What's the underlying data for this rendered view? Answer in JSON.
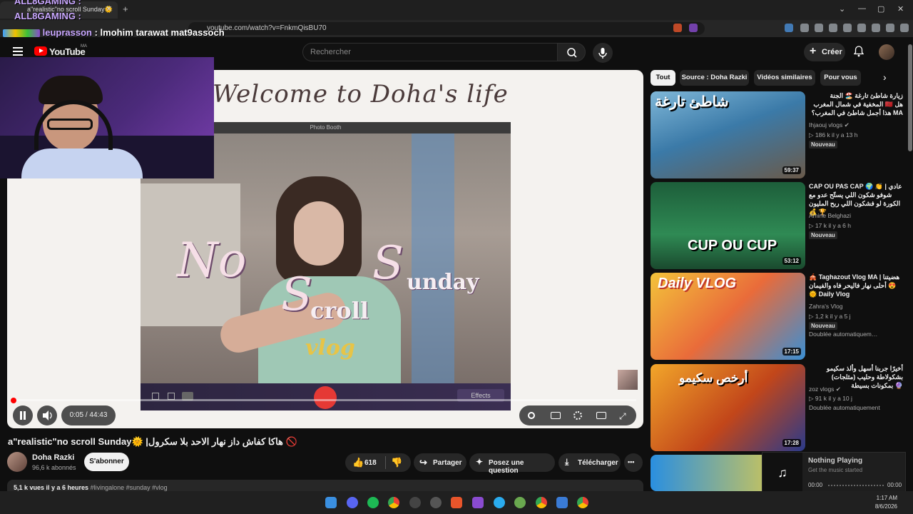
{
  "browser": {
    "tab_title": "a\"realistic\"no scroll Sunday🌞",
    "tab_close": "✕",
    "new_tab": "+",
    "url": "youtube.com/watch?v=FnkmQisBU70"
  },
  "overlay": {
    "name_1": "ALL8GAMING :",
    "name_2": "ALL8GAMING :",
    "chat_user": "leuprasson",
    "chat_message": " : lmohim tarawat mat9assoch"
  },
  "header": {
    "logo": "YouTube",
    "country": "MA",
    "search_placeholder": "Rechercher",
    "create_label": "Créer",
    "create_plus": "+"
  },
  "player": {
    "welcome_text": "Welcome to Doha's life",
    "booth_title": "Photo Booth",
    "effects_label": "Effects",
    "overlay_no": "No",
    "overlay_scroll_s": "S",
    "overlay_scroll": "croll",
    "overlay_sunday_s": "S",
    "overlay_sunday": "unday",
    "overlay_vlog": "vlog",
    "time_display": "0:05 / 44:43",
    "progress": 0.0019
  },
  "video": {
    "title": "a\"realistic\"no scroll Sunday🌞 |هاكا كفاش داز نهار الاحد بلا سكرول 🚫",
    "channel": "Doha Razki",
    "subscribers": "96,6 k abonnés",
    "subscribe_label": "S'abonner",
    "likes": "618",
    "share_label": "Partager",
    "ask_label": "Posez une question",
    "download_label": "Télécharger",
    "more": "•••",
    "views": "5,1 k vues  il y a 6 heures ",
    "tags": "#livingalone #sunday #vlog"
  },
  "chips": [
    "Tout",
    "Source : Doha Razki",
    "Vidéos similaires",
    "Pour vous"
  ],
  "recommendations": [
    {
      "title": "زيارة شاطئ تارغة 🏖️ الجنة المخفية في شمال المغرب 🇲🇦 هل هذا أجمل شاطئ في المغرب؟ MA",
      "channel": "Ihjaouj vlogs ✔",
      "meta": "▷ 186 k  il y a 13 h",
      "badge": "Nouveau",
      "duration": "59:37",
      "thumb_text": "شاطئ تارغة"
    },
    {
      "title": "CAP OU PAS CAP 🌍 👏 | عادي شوفو شكون اللي يستّح عدو مع الكورة لو فشكون اللي ربح المليون 💰 🏆",
      "channel": "Amine Belghazi",
      "meta": "▷ 17 k  il y a 6 h",
      "badge": "Nouveau",
      "duration": "53:12",
      "thumb_text": "CUP OU CUP"
    },
    {
      "title": "🎪 Taghazout Vlog MA | هضيتنا 😍 أحلى نهار فاليحر فاه والفيمان 🌞 Daily Vlog",
      "channel": "Zahra's Vlog",
      "meta": "▷ 1,2 k  il y a 5 j",
      "badge": "Nouveau",
      "badge2": "Doublée automatiquem…",
      "duration": "17:15",
      "thumb_text": "Daily VLOG"
    },
    {
      "title": "أخيرًا جربنا أسهل وألذ سكيمو بشكولاطة وحليب (مثلجات) بمكونات بسيطة 🔮",
      "channel": "zoz vlogs ✔",
      "meta": "▷ 91 k  il y a 10 j",
      "badge2": "Doublée automatiquement",
      "duration": "17:28",
      "thumb_text": "أرخص سكيمو"
    }
  ],
  "now_playing": {
    "title": "Nothing Playing",
    "subtitle": "Get the music started",
    "time_start": "00:00",
    "time_end": "00:00"
  },
  "taskbar": {
    "time": "1:17 AM",
    "date": "8/6/2026"
  },
  "colors": {
    "yt_red": "#ff0000",
    "bg": "#0f0f0f",
    "chip_bg": "#272727"
  }
}
